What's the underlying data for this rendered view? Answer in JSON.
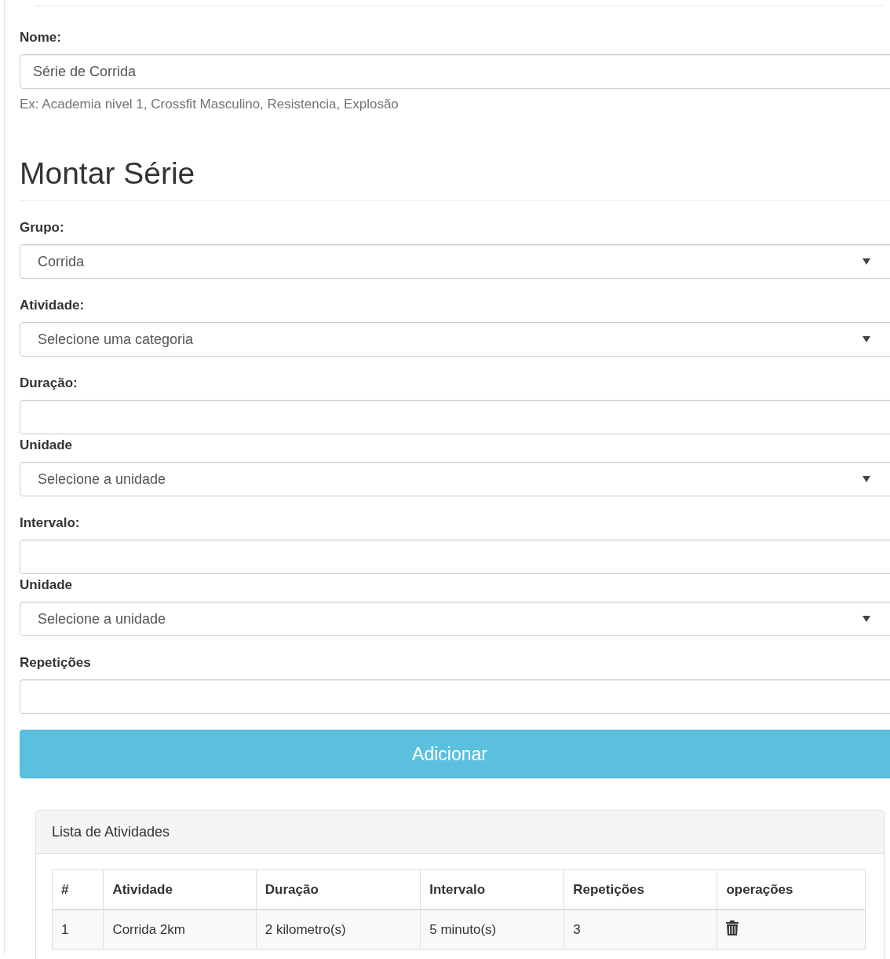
{
  "name_field": {
    "label": "Nome:",
    "value": "Série de Corrida",
    "help": "Ex: Academia nivel 1, Crossfit Masculino, Resistencia, Explosão"
  },
  "section_title": "Montar Série",
  "fields": [
    {
      "kind": "select",
      "label": "Grupo:",
      "value": "Corrida"
    },
    {
      "kind": "select",
      "label": "Atividade:",
      "value": "Selecione uma categoria"
    },
    {
      "kind": "input",
      "label": "Duração:"
    },
    {
      "kind": "select",
      "label": "Unidade",
      "value": "Selecione a unidade"
    },
    {
      "kind": "input",
      "label": "Intervalo:"
    },
    {
      "kind": "select",
      "label": "Unidade",
      "value": "Selecione a unidade"
    },
    {
      "kind": "input",
      "label": "Repetições"
    }
  ],
  "add_button": "Adicionar",
  "panel": {
    "title": "Lista de Atividades",
    "table": {
      "columns": [
        "#",
        "Atividade",
        "Duração",
        "Intervalo",
        "Repetições",
        "operações"
      ],
      "rows": [
        {
          "cells": [
            "1",
            "Corrida 2km",
            "2 kilometro(s)",
            "5 minuto(s)",
            "3"
          ]
        }
      ]
    }
  }
}
